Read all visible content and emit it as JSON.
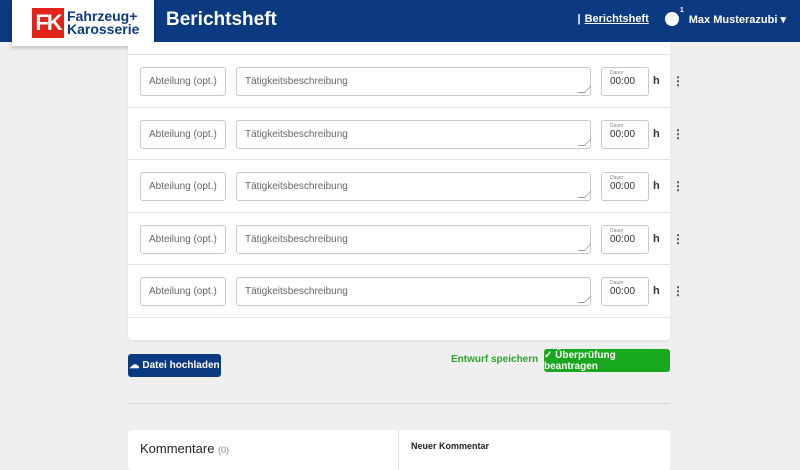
{
  "header": {
    "logo_mark": "FK",
    "logo_line1": "Fahrzeug+",
    "logo_line2": "Karosserie",
    "title": "Berichtsheft",
    "nav_link": "Berichtsheft",
    "notification_count": "1",
    "user": "Max Musterazubi"
  },
  "entries": [
    {
      "dept_placeholder": "Abteilung (opt.)",
      "desc_placeholder": "Tätigkeitsbeschreibung",
      "duration_label": "Dauer",
      "duration": "00:00",
      "unit": "h"
    },
    {
      "dept_placeholder": "Abteilung (opt.)",
      "desc_placeholder": "Tätigkeitsbeschreibung",
      "duration_label": "Dauer",
      "duration": "00:00",
      "unit": "h"
    },
    {
      "dept_placeholder": "Abteilung (opt.)",
      "desc_placeholder": "Tätigkeitsbeschreibung",
      "duration_label": "Dauer",
      "duration": "00:00",
      "unit": "h"
    },
    {
      "dept_placeholder": "Abteilung (opt.)",
      "desc_placeholder": "Tätigkeitsbeschreibung",
      "duration_label": "Dauer",
      "duration": "00:00",
      "unit": "h"
    },
    {
      "dept_placeholder": "Abteilung (opt.)",
      "desc_placeholder": "Tätigkeitsbeschreibung",
      "duration_label": "Dauer",
      "duration": "00:00",
      "unit": "h"
    }
  ],
  "actions": {
    "upload": "Datei hochladen",
    "draft": "Entwurf speichern",
    "review": "✓ Überprüfung beantragen"
  },
  "comments": {
    "title": "Kommentare",
    "count": "(0)",
    "new": "Neuer Kommentar"
  }
}
